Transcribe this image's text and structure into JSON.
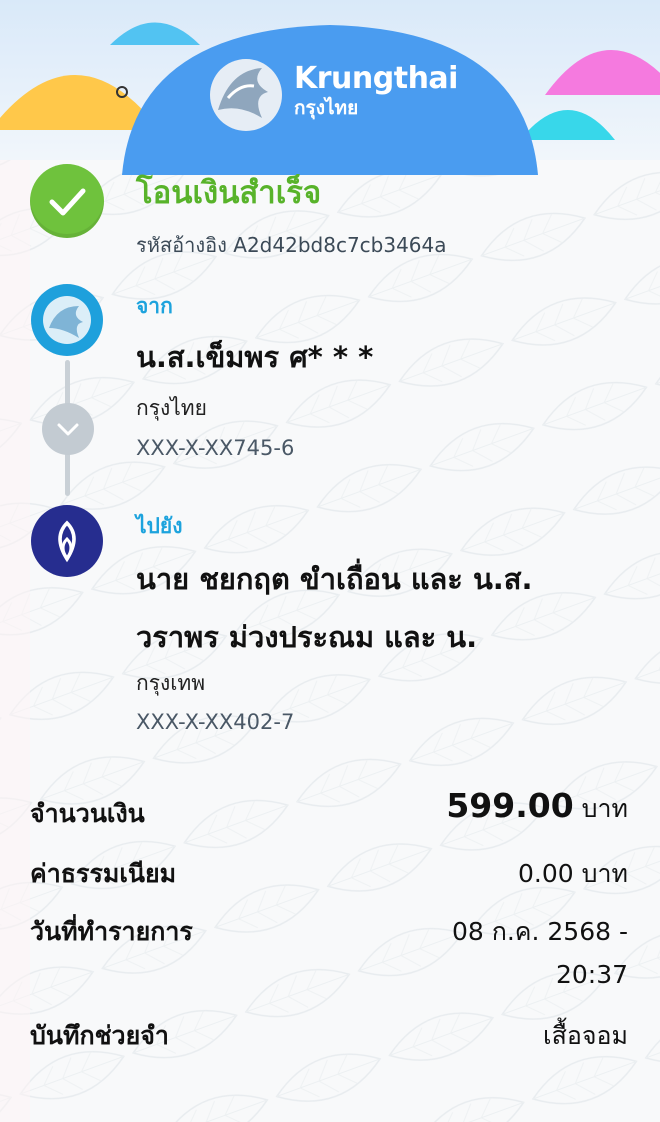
{
  "brand": {
    "name_en": "Krungthai",
    "name_th": "กรุงไทย"
  },
  "status": {
    "title": "โอนเงินสำเร็จ",
    "reference": "รหัสอ้างอิง A2d42bd8c7cb3464a"
  },
  "sender": {
    "label": "จาก",
    "name": "น.ส.เข็มพร ศ* * *",
    "bank": "กรุงไทย",
    "account": "XXX-X-XX745-6"
  },
  "recipient": {
    "label": "ไปยัง",
    "name_line1": "นาย ชยกฤต ขำเถื่อน และ น.ส.",
    "name_line2": "วราพร ม่วงประณม และ น.",
    "bank": "กรุงเทพ",
    "account": "XXX-X-XX402-7"
  },
  "details": {
    "amount_label": "จำนวนเงิน",
    "amount_value": "599.00",
    "amount_unit": "บาท",
    "fee_label": "ค่าธรรมเนียม",
    "fee_value": "0.00 บาท",
    "date_label": "วันที่ทำรายการ",
    "date_value": "08 ก.ค. 2568 -",
    "time_value": "20:37",
    "memo_label": "บันทึกช่วยจำ",
    "memo_value": "เสื้อจอม"
  },
  "colors": {
    "success": "#6fc23d",
    "krungthai_blue": "#1ea0dc",
    "bangkok_bank_navy": "#262d8f",
    "header_arc": "#4a9cf0"
  }
}
